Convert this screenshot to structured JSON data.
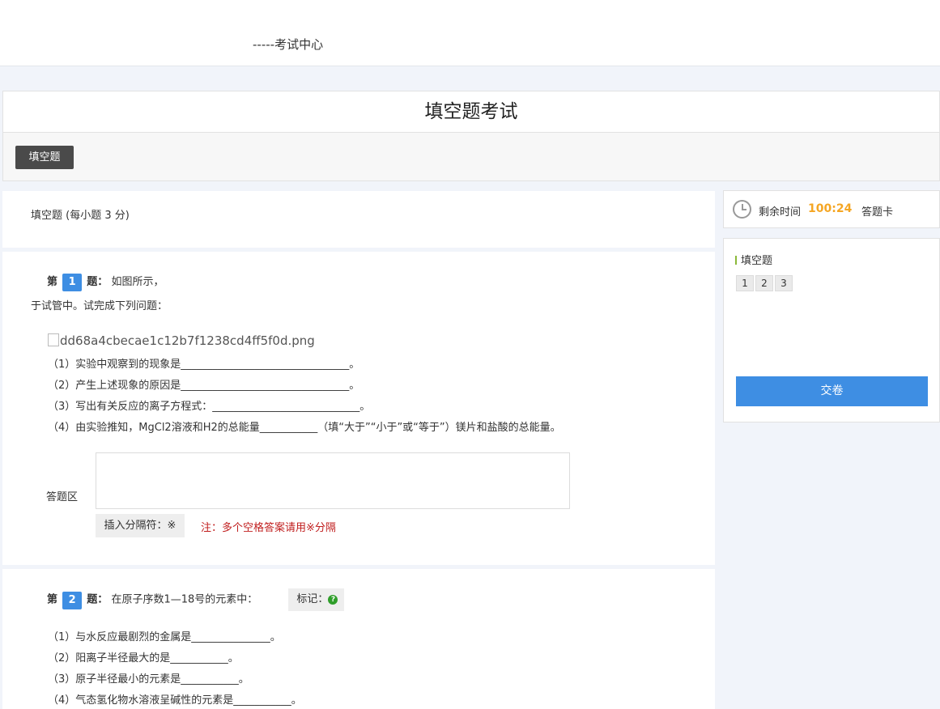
{
  "header": {
    "title": "-----考试中心"
  },
  "exam": {
    "title": "填空题考试",
    "type_button": "填空题"
  },
  "section": {
    "heading": "填空题 (每小题 3 分)"
  },
  "q1": {
    "prefix": "第",
    "number": "1",
    "suffix": "题：",
    "text": "如图所示，",
    "line2": "于试管中。试完成下列问题：",
    "image_alt": "dd68a4cbecae1c12b7f1238cd4ff5f0d.png",
    "subs": [
      "（1）实验中观察到的现象是________________________________。",
      "（2）产生上述现象的原因是________________________________。",
      "（3）写出有关反应的离子方程式：____________________________。",
      "（4）由实验推知，MgCl2溶液和H2的总能量___________（填“大于”“小于”或“等于”）镁片和盐酸的总能量。"
    ],
    "answer_label": "答题区",
    "insert_btn": "插入分隔符：※",
    "note": "注：多个空格答案请用※分隔"
  },
  "q2": {
    "prefix": "第",
    "number": "2",
    "suffix": "题：",
    "text": "在原子序数1—18号的元素中：",
    "mark_label": "标记：",
    "subs": [
      "（1）与水反应最剧烈的金属是_______________。",
      "（2）阳离子半径最大的是___________。",
      "（3）原子半径最小的元素是___________。",
      "（4）气态氢化物水溶液呈碱性的元素是___________。"
    ]
  },
  "sidebar": {
    "timer_label": "剩余时间",
    "timer_value": "100:24",
    "card_label": "答题卡",
    "card_section": "填空题",
    "numbers": [
      "1",
      "2",
      "3"
    ],
    "submit": "交卷"
  },
  "colors": {
    "accent": "#3e8ee3",
    "timer": "#f5a623",
    "note": "#c01d1d"
  }
}
